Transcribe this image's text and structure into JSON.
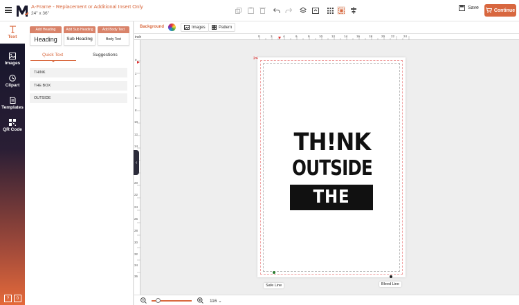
{
  "header": {
    "title": "A-Frame - Replacement or Additional Insert Only",
    "size": "24\" x 36\"",
    "save_label": "Save",
    "continue_label": "Continue"
  },
  "sidebar": {
    "items": [
      {
        "label": "Text",
        "icon": "text-icon"
      },
      {
        "label": "Images",
        "icon": "image-icon"
      },
      {
        "label": "Clipart",
        "icon": "clock-icon"
      },
      {
        "label": "Templates",
        "icon": "templates-icon"
      },
      {
        "label": "QR Code",
        "icon": "qr-icon"
      }
    ],
    "bottom": [
      "?",
      "0"
    ]
  },
  "text_panel": {
    "add_buttons": [
      {
        "label": "Add Heading",
        "preview": "Heading"
      },
      {
        "label": "Add Sub Heading",
        "preview": "Sub Heading"
      },
      {
        "label": "Add Body Text",
        "preview": "Body Text"
      }
    ],
    "tabs": [
      "Quick Text",
      "Suggestions"
    ],
    "quick_text": [
      "THINK",
      "THE BOX",
      "OUTSIDE"
    ]
  },
  "canvas_toolbar": {
    "background_label": "Background",
    "images_label": "Images",
    "pattern_label": "Pattern"
  },
  "ruler": {
    "unit": "inch",
    "top_numbers": [
      "0",
      "2",
      "4",
      "6",
      "8",
      "10",
      "12",
      "14",
      "16",
      "18",
      "20",
      "22",
      "24"
    ],
    "left_numbers": [
      "0",
      "2",
      "4",
      "6",
      "8",
      "10",
      "12",
      "14",
      "16",
      "18",
      "20",
      "22",
      "24",
      "26",
      "28",
      "30",
      "32",
      "34",
      "36"
    ]
  },
  "design": {
    "line1": "TH!NK",
    "line2": "OUTSIDE",
    "line3": "THE BOX"
  },
  "guides": {
    "safe_label": "Safe Line",
    "bleed_label": "Bleed Line"
  },
  "zoom": {
    "value": "116",
    "level": 0.17
  },
  "colors": {
    "accent": "#d8673f",
    "safe_marker": "#2e7d32",
    "bleed_marker": "#222222"
  }
}
